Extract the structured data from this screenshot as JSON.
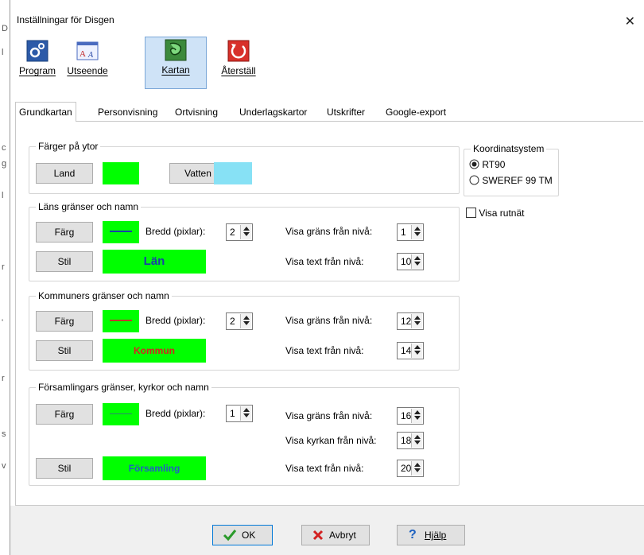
{
  "window": {
    "title": "Inställningar för Disgen",
    "close_glyph": "✕"
  },
  "toolbar": {
    "items": [
      {
        "label": "Program",
        "icon": "program-gear-icon"
      },
      {
        "label": "Utseende",
        "icon": "appearance-font-icon"
      },
      {
        "label": "Kartan",
        "icon": "map-icon",
        "active": true
      },
      {
        "label": "Återställ",
        "icon": "reset-arrow-icon"
      }
    ]
  },
  "tabs": [
    {
      "label": "Grundkartan",
      "active": true
    },
    {
      "label": "Personvisning"
    },
    {
      "label": "Ortvisning"
    },
    {
      "label": "Underlagskartor"
    },
    {
      "label": "Utskrifter"
    },
    {
      "label": "Google-export"
    }
  ],
  "colors_group": {
    "title": "Färger på ytor",
    "land_label": "Land",
    "land_color": "#00ff00",
    "water_label": "Vatten",
    "water_color": "#87e1f5"
  },
  "lans": {
    "title": "Läns gränser och namn",
    "color_label": "Färg",
    "line_color": "#1a3fa8",
    "width_label": "Bredd (pixlar):",
    "width_value": "2",
    "border_level_label": "Visa gräns från nivå:",
    "border_level_value": "1",
    "style_label": "Stil",
    "sample_text": "Län",
    "sample_color": "#1a3fa8",
    "text_level_label": "Visa text från nivå:",
    "text_level_value": "10"
  },
  "kommun": {
    "title": "Kommuners gränser och namn",
    "color_label": "Färg",
    "line_color": "#c0392b",
    "width_label": "Bredd (pixlar):",
    "width_value": "2",
    "border_level_label": "Visa gräns från nivå:",
    "border_level_value": "12",
    "style_label": "Stil",
    "sample_text": "Kommun",
    "sample_color": "#d92020",
    "text_level_label": "Visa text från nivå:",
    "text_level_value": "14"
  },
  "forsamling": {
    "title": "Församlingars gränser, kyrkor och namn",
    "color_label": "Färg",
    "line_color": "#2a8a6a",
    "width_label": "Bredd (pixlar):",
    "width_value": "1",
    "border_level_label": "Visa gräns från nivå:",
    "border_level_value": "16",
    "church_level_label": "Visa kyrkan från nivå:",
    "church_level_value": "18",
    "style_label": "Stil",
    "sample_text": "Församling",
    "sample_color": "#2060c0",
    "text_level_label": "Visa text från nivå:",
    "text_level_value": "20"
  },
  "coord": {
    "title": "Koordinatsystem",
    "options": [
      {
        "label": "RT90",
        "checked": true
      },
      {
        "label": "SWEREF 99 TM",
        "checked": false
      }
    ]
  },
  "grid_checkbox": {
    "label": "Visa rutnät",
    "checked": false
  },
  "buttons": {
    "ok": "OK",
    "cancel": "Avbryt",
    "help": "Hjälp"
  }
}
